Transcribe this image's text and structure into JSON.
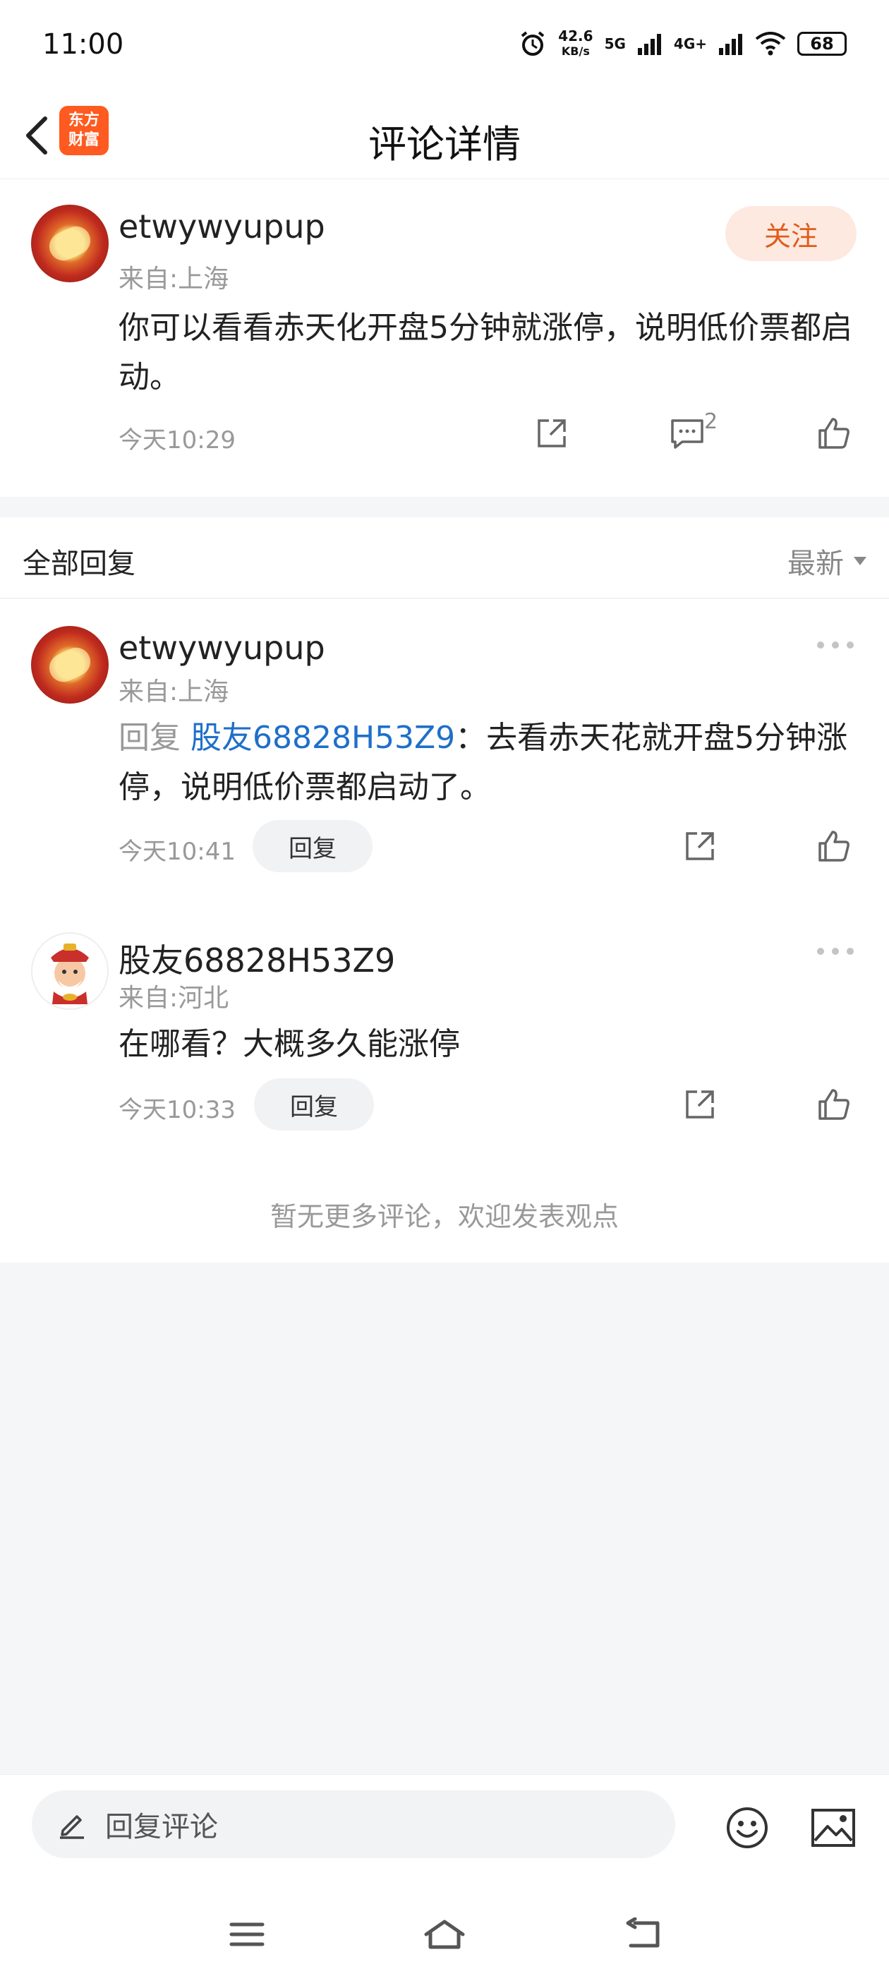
{
  "status_bar": {
    "time": "11:00",
    "net_speed": "42.6",
    "net_unit": "KB/s",
    "net_5g": "5G",
    "net_4g": "4G+",
    "battery": "68"
  },
  "nav": {
    "title": "评论详情",
    "logo_line1": "东方",
    "logo_line2": "财富"
  },
  "main_comment": {
    "username": "etwywyupup",
    "location": "来自:上海",
    "content": "你可以看看赤天化开盘5分钟就涨停，说明低价票都启动。",
    "time": "今天10:29",
    "reply_count": "2",
    "follow_label": "关注"
  },
  "replies_section": {
    "title": "全部回复",
    "sort_label": "最新"
  },
  "replies": [
    {
      "username": "etwywyupup",
      "location": "来自:上海",
      "reply_prefix": "回复",
      "mention": "股友68828H53Z9",
      "content": "：去看赤天花就开盘5分钟涨停，说明低价票都启动了。",
      "time": "今天10:41",
      "reply_label": "回复"
    },
    {
      "username": "股友68828H53Z9",
      "location": "来自:河北",
      "content": "在哪看？大概多久能涨停",
      "time": "今天10:33",
      "reply_label": "回复"
    }
  ],
  "footer_note": "暂无更多评论，欢迎发表观点",
  "bottom_bar": {
    "input_placeholder": "回复评论"
  },
  "colors": {
    "accent": "#e25b1b",
    "mention": "#1f6fc9",
    "logo": "#ff5a1f"
  }
}
